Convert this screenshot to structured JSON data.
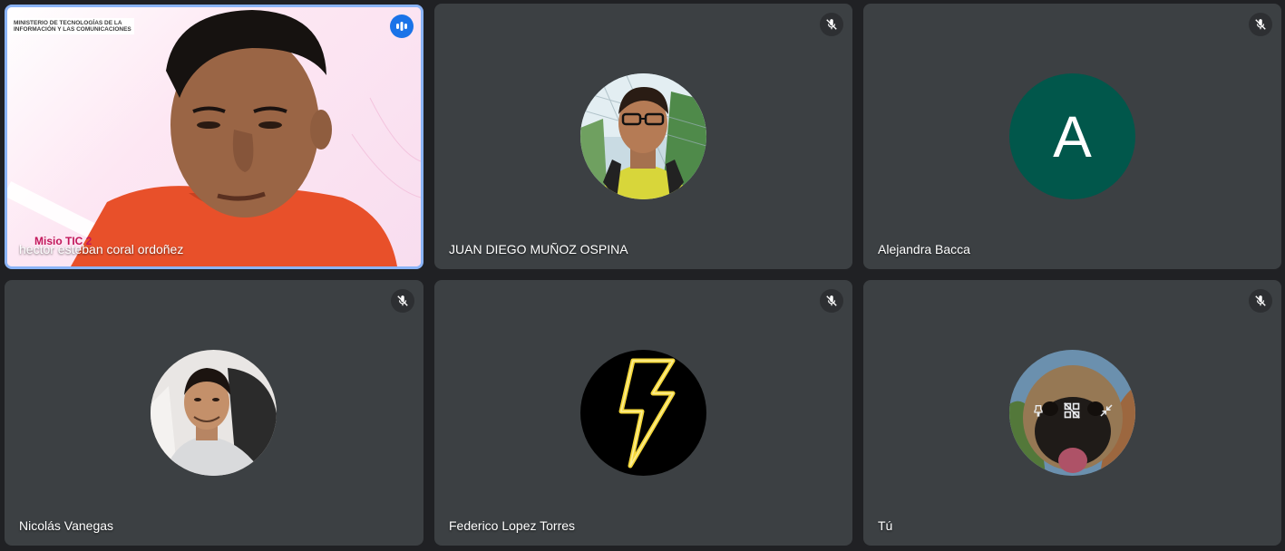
{
  "tiles": [
    {
      "name": "hector esteban coral ordoñez",
      "type": "video",
      "overlay": {
        "ministry": "MINISTERIO DE TECNOLOGÍAS DE LA INFORMACIÓN Y LAS COMUNICACIONES",
        "logo": "Misio TIC 2"
      }
    },
    {
      "name": "JUAN DIEGO MUÑOZ OSPINA",
      "type": "photo-avatar",
      "muted": true
    },
    {
      "name": "Alejandra Bacca",
      "type": "letter-avatar",
      "letter": "A",
      "avatar_color": "#01574b",
      "muted": true
    },
    {
      "name": "Nicolás Vanegas",
      "type": "photo-avatar",
      "muted": true
    },
    {
      "name": "Federico Lopez Torres",
      "type": "icon-avatar",
      "icon": "lightning-bolt-icon",
      "muted": true
    },
    {
      "name": "Tú",
      "type": "photo-avatar",
      "muted": true,
      "hover_actions": [
        "pin-icon",
        "remove-tile-icon",
        "minimize-icon"
      ]
    }
  ],
  "colors": {
    "background": "#202124",
    "tile": "#3c4043",
    "active_border": "#8ab4f8",
    "speaking": "#1a73e8"
  }
}
